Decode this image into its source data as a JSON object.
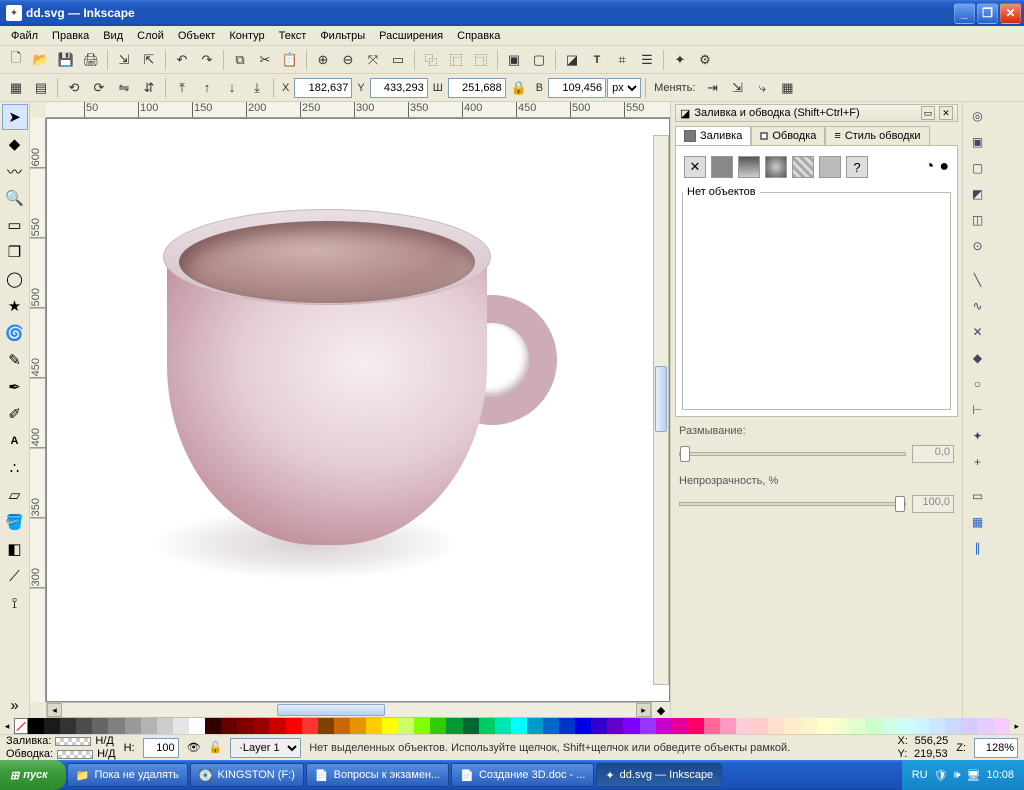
{
  "window": {
    "title": "dd.svg — Inkscape"
  },
  "menu": [
    "Файл",
    "Правка",
    "Вид",
    "Слой",
    "Объект",
    "Контур",
    "Текст",
    "Фильтры",
    "Расширения",
    "Справка"
  ],
  "coords_toolbar": {
    "x_label": "X",
    "x": "182,637",
    "y_label": "Y",
    "y": "433,293",
    "w_label": "Ш",
    "w": "251,688",
    "h_label": "В",
    "h": "109,456",
    "unit": "px",
    "change_label": "Менять:"
  },
  "ruler_h_ticks": [
    "50",
    "100",
    "150",
    "200",
    "250",
    "300",
    "350",
    "400",
    "450",
    "500",
    "550"
  ],
  "ruler_v_ticks": [
    "600",
    "550",
    "500",
    "450",
    "400",
    "350",
    "300"
  ],
  "dock": {
    "title": "Заливка и обводка (Shift+Ctrl+F)",
    "tabs": [
      "Заливка",
      "Обводка",
      "Стиль обводки"
    ],
    "no_objects": "Нет объектов",
    "blur_label": "Размывание:",
    "blur_value": "0,0",
    "opacity_label": "Непрозрачность, %",
    "opacity_value": "100,0"
  },
  "status": {
    "fill_label": "Заливка:",
    "fill_value": "Н/Д",
    "stroke_label": "Обводка:",
    "stroke_value": "Н/Д",
    "n_label": "Н:",
    "n_value": "100",
    "layer": "Layer 1",
    "hint": "Нет выделенных объектов. Используйте щелчок, Shift+щелчок или обведите объекты рамкой.",
    "xy_label_x": "X:",
    "xy_x": "556,25",
    "xy_label_y": "Y:",
    "xy_y": "219,53",
    "z_label": "Z:",
    "z": "128%"
  },
  "taskbar": {
    "start": "пуск",
    "items": [
      "Пока не удалять",
      "KINGSTON (F:)",
      "Вопросы к экзамен...",
      "Создание 3D.doc - ...",
      "dd.svg — Inkscape"
    ],
    "lang": "RU",
    "time": "10:08"
  },
  "palette": [
    "#000000",
    "#1a1a1a",
    "#333333",
    "#4d4d4d",
    "#666666",
    "#808080",
    "#999999",
    "#b3b3b3",
    "#cccccc",
    "#e6e6e6",
    "#ffffff",
    "#330000",
    "#660000",
    "#800000",
    "#990000",
    "#cc0000",
    "#ff0000",
    "#ff3333",
    "#804000",
    "#cc6600",
    "#e69500",
    "#ffcc00",
    "#ffff00",
    "#ccff66",
    "#80ff00",
    "#33cc00",
    "#009933",
    "#006633",
    "#00cc66",
    "#00e6b3",
    "#00ffff",
    "#0099cc",
    "#0066cc",
    "#0033cc",
    "#0000e6",
    "#3300cc",
    "#6600cc",
    "#8000ff",
    "#9933ff",
    "#cc00cc",
    "#e60099",
    "#ff0066",
    "#ff6699",
    "#ff99c2",
    "#ffccd9",
    "#ffcccc",
    "#ffe0cc",
    "#ffeccc",
    "#fff5cc",
    "#ffffcc",
    "#f2ffcc",
    "#e0ffcc",
    "#ccffcc",
    "#ccffe6",
    "#ccfff8",
    "#ccf5ff",
    "#cce6ff",
    "#ccd9ff",
    "#d4ccff",
    "#e6ccff",
    "#f5ccff"
  ]
}
